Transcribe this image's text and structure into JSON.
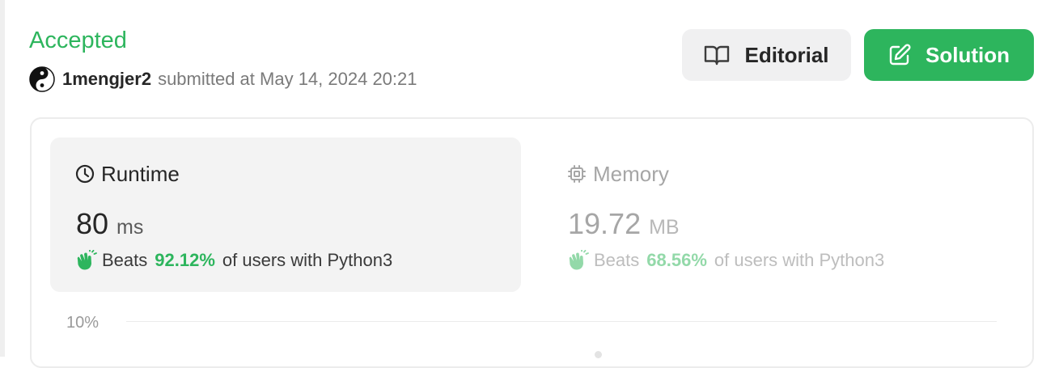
{
  "submission": {
    "status": "Accepted",
    "username": "1mengjer2",
    "submitted_text": "submitted at May 14, 2024 20:21"
  },
  "buttons": {
    "editorial_label": "Editorial",
    "solution_label": "Solution"
  },
  "runtime": {
    "label": "Runtime",
    "value": "80",
    "unit": "ms",
    "beats_prefix": "Beats",
    "beats_percent": "92.12%",
    "beats_suffix": "of users with Python3"
  },
  "memory": {
    "label": "Memory",
    "value": "19.72",
    "unit": "MB",
    "beats_prefix": "Beats",
    "beats_percent": "68.56%",
    "beats_suffix": "of users with Python3"
  },
  "chart": {
    "y_tick_label": "10%"
  },
  "colors": {
    "accent_green": "#2db55d",
    "muted_green": "#93d9a9"
  }
}
